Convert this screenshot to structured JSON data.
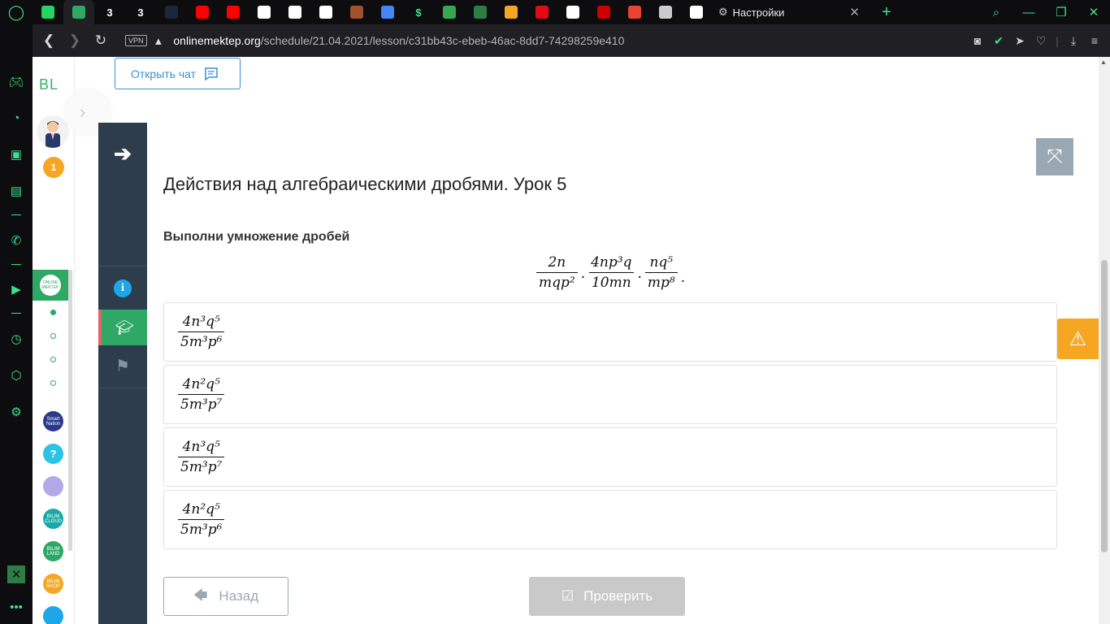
{
  "browser": {
    "tabs": [
      {
        "icon": "whatsapp-icon",
        "text": "",
        "color": "#25d366"
      },
      {
        "icon": "online-mektep-icon",
        "text": "",
        "color": "#2fa866",
        "active": true
      },
      {
        "icon": "tab-3-icon",
        "text": "3",
        "color": "#000000"
      },
      {
        "icon": "tab-3-icon",
        "text": "3",
        "color": "#000000"
      },
      {
        "icon": "steam-icon",
        "text": "",
        "color": "#1b2838"
      },
      {
        "icon": "youtube-icon",
        "text": "",
        "color": "#ff0000"
      },
      {
        "icon": "youtube-icon",
        "text": "",
        "color": "#ff0000"
      },
      {
        "icon": "headphones-icon",
        "text": "",
        "color": "#ffffff"
      },
      {
        "icon": "document-icon",
        "text": "",
        "color": "#ffffff"
      },
      {
        "icon": "headphones-icon",
        "text": "",
        "color": "#ffffff"
      },
      {
        "icon": "game-icon",
        "text": "",
        "color": "#a0522d"
      },
      {
        "icon": "translate-icon",
        "text": "",
        "color": "#4285f4"
      },
      {
        "icon": "dollar-icon",
        "text": "$",
        "color": "#3fe08a"
      },
      {
        "icon": "maps-icon",
        "text": "",
        "color": "#34a853"
      },
      {
        "icon": "green-app-icon",
        "text": "",
        "color": "#2d7d46"
      },
      {
        "icon": "search-q-icon",
        "text": "",
        "color": "#f5a623"
      },
      {
        "icon": "netflix-icon",
        "text": "",
        "color": "#e50914"
      },
      {
        "icon": "document-icon",
        "text": "",
        "color": "#ffffff"
      },
      {
        "icon": "red-app-icon",
        "text": "",
        "color": "#cc0000"
      },
      {
        "icon": "gmail-icon",
        "text": "",
        "color": "#ea4335"
      },
      {
        "icon": "gear-icon",
        "text": "",
        "color": "#cccccc"
      },
      {
        "icon": "white-app-icon",
        "text": "",
        "color": "#ffffff"
      }
    ],
    "settings_tab_label": "Настройки",
    "url_host": "onlinemektep.org",
    "url_path": "/schedule/21.04.2021/lesson/c31bb43c-ebeb-46ac-8dd7-74298259e410",
    "vpn_label": "VPN",
    "accent_color": "#3fe08a"
  },
  "site": {
    "logo_text": "BL",
    "notification_count": "1",
    "open_chat_label": "Открыть чат",
    "om_logo_text": "ONLINE MEKTEP",
    "apps": [
      {
        "text": "Smart Nation",
        "color": "#2a3a8a"
      },
      {
        "text": "?",
        "color": "#29c3e8"
      },
      {
        "text": "",
        "color": "#b3a9e6"
      },
      {
        "text": "BILIM CLOUD",
        "color": "#1aa8a8"
      },
      {
        "text": "BILIM LAND",
        "color": "#2fa866"
      },
      {
        "text": "BILIM SHOP",
        "color": "#f5a623"
      },
      {
        "text": "",
        "color": "#1ea7e8"
      }
    ]
  },
  "lesson": {
    "title": "Действия над алгебраическими дробями. Урок 5",
    "task_label": "Выполни умножение дробей",
    "expression": [
      {
        "num": "2n",
        "den": "mqp²"
      },
      {
        "num": "4np³q",
        "den": "10mn"
      },
      {
        "num": "nq⁵",
        "den": "mp⁸"
      }
    ],
    "options": [
      {
        "num": "4n³q⁵",
        "den": "5m³p⁶"
      },
      {
        "num": "4n²q⁵",
        "den": "5m³p⁷"
      },
      {
        "num": "4n³q⁵",
        "den": "5m³p⁷"
      },
      {
        "num": "4n²q⁵",
        "den": "5m³p⁶"
      }
    ],
    "back_label": "Назад",
    "check_label": "Проверить"
  }
}
